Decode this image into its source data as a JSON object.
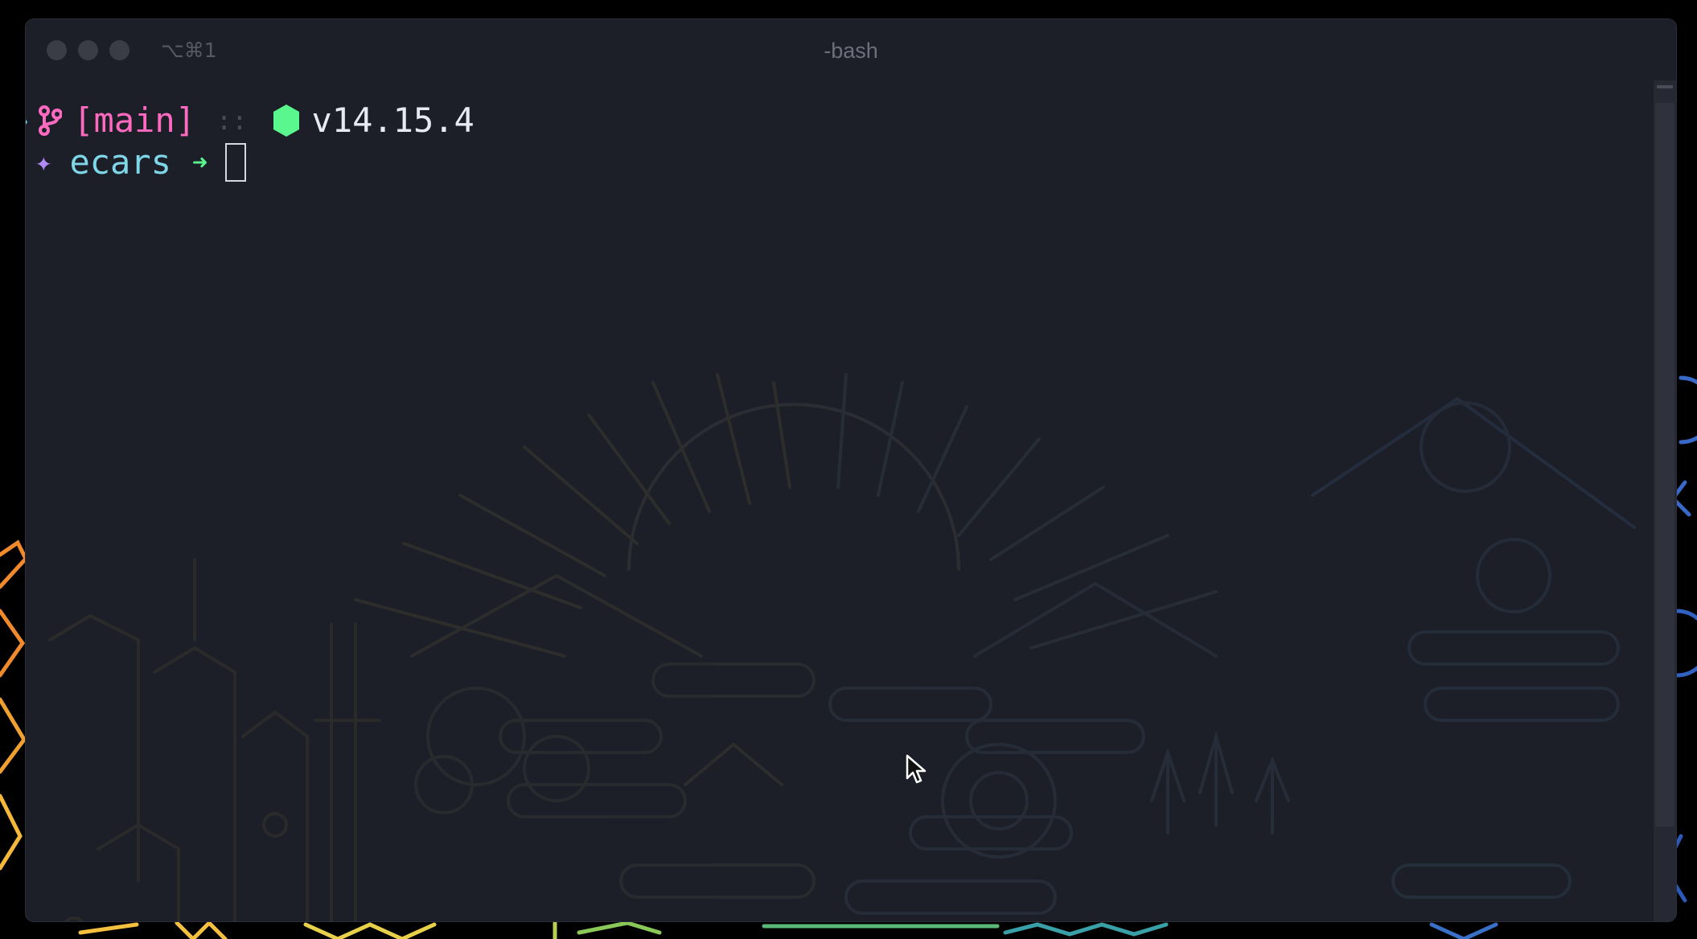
{
  "window": {
    "title": "-bash",
    "shortcut": "⌥⌘1"
  },
  "prompt": {
    "line1": {
      "arrow": "❯",
      "branch_icon": "git-branch-icon",
      "branch": "[main]",
      "separator": "::",
      "node_icon": "node-hexagon-icon",
      "node_version": "v14.15.4"
    },
    "line2": {
      "star": "✦",
      "directory": "ecars",
      "arrow": "➜"
    }
  },
  "colors": {
    "background": "#1d1f28",
    "branch": "#ff6ac1",
    "directory": "#7ed6e8",
    "node": "#5af78e",
    "star": "#b08bf8"
  }
}
